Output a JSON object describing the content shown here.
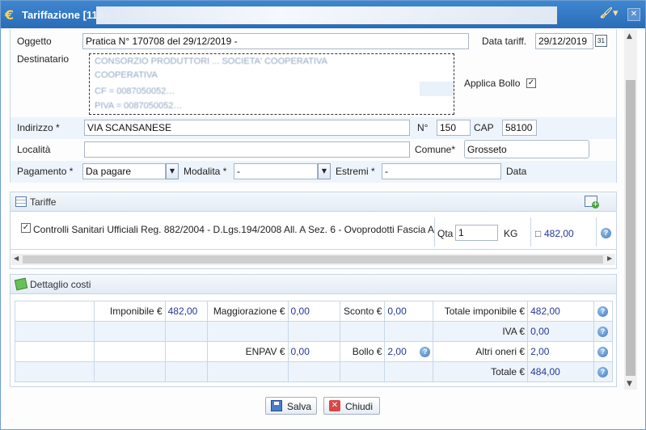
{
  "window": {
    "title": "Tariffazione [119 -",
    "accent": "#2f76c4"
  },
  "form": {
    "oggetto_label": "Oggetto",
    "oggetto_value": "Pratica N° 170708 del 29/12/2019 -",
    "data_tariff_label": "Data tariff.",
    "data_tariff_value": "29/12/2019",
    "destinatario_label": "Destinatario",
    "applica_bollo_label": "Applica Bollo",
    "applica_bollo_checked": true,
    "indirizzo_label": "Indirizzo *",
    "indirizzo_value": "VIA SCANSANESE",
    "numero_label": "N°",
    "numero_value": "150",
    "cap_label": "CAP",
    "cap_value": "58100",
    "localita_label": "Località",
    "localita_value": "",
    "comune_label": "Comune*",
    "comune_value": "Grosseto",
    "pagamento_label": "Pagamento *",
    "pagamento_value": "Da pagare",
    "modalita_label": "Modalita *",
    "modalita_value": "-",
    "estremi_label": "Estremi *",
    "estremi_value": "-",
    "data_label": "Data"
  },
  "tariffe": {
    "title": "Tariffe",
    "item_checked": true,
    "item_text": "Controlli Sanitari Ufficiali Reg. 882/2004 - D.Lgs.194/2008 All. A Sez. 6 - Ovoprodotti Fascia A",
    "qta_label": "Qta",
    "qta_value": "1",
    "unit": "KG",
    "amount": "482,00",
    "currency_glyph": "□"
  },
  "dettaglio": {
    "title": "Dettaglio costi",
    "imponibile_label": "Imponibile €",
    "imponibile_value": "482,00",
    "maggiorazione_label": "Maggiorazione €",
    "maggiorazione_value": "0,00",
    "sconto_label": "Sconto €",
    "sconto_value": "0,00",
    "totale_imponibile_label": "Totale imponibile €",
    "totale_imponibile_value": "482,00",
    "iva_label": "IVA €",
    "iva_value": "0,00",
    "enpav_label": "ENPAV €",
    "enpav_value": "0,00",
    "bollo_label": "Bollo €",
    "bollo_value": "2,00",
    "altri_oneri_label": "Altri oneri €",
    "altri_oneri_value": "2,00",
    "totale_label": "Totale €",
    "totale_value": "484,00"
  },
  "buttons": {
    "salva": "Salva",
    "chiudi": "Chiudi"
  },
  "icons": {
    "app": "euro-icon",
    "help": "?",
    "calendar": "31"
  }
}
